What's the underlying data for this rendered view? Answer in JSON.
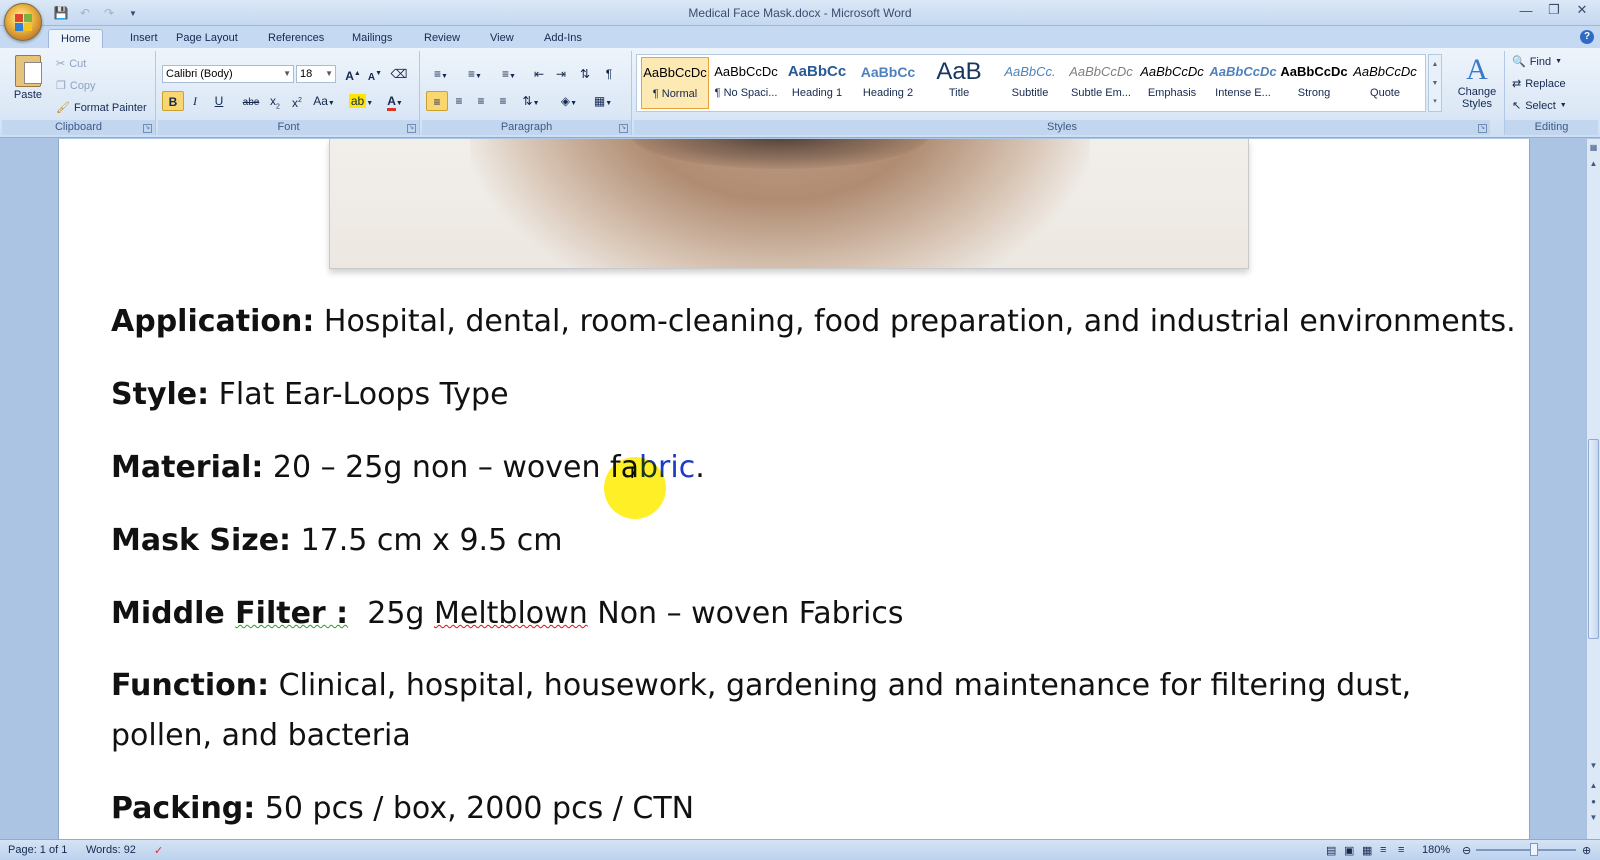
{
  "window": {
    "title": "Medical Face Mask.docx - Microsoft Word"
  },
  "tabs": [
    {
      "label": "Home"
    },
    {
      "label": "Insert"
    },
    {
      "label": "Page Layout"
    },
    {
      "label": "References"
    },
    {
      "label": "Mailings"
    },
    {
      "label": "Review"
    },
    {
      "label": "View"
    },
    {
      "label": "Add-Ins"
    }
  ],
  "clipboard": {
    "paste": "Paste",
    "cut": "Cut",
    "copy": "Copy",
    "format_painter": "Format Painter",
    "label": "Clipboard"
  },
  "font": {
    "name": "Calibri (Body)",
    "size": "18",
    "label": "Font"
  },
  "paragraph": {
    "label": "Paragraph"
  },
  "styles": {
    "label": "Styles",
    "items": [
      {
        "sample": "AaBbCcDc",
        "name": "¶ Normal"
      },
      {
        "sample": "AaBbCcDc",
        "name": "¶ No Spaci..."
      },
      {
        "sample": "AaBbCc",
        "name": "Heading 1"
      },
      {
        "sample": "AaBbCc",
        "name": "Heading 2"
      },
      {
        "sample": "AaB",
        "name": "Title"
      },
      {
        "sample": "AaBbCc.",
        "name": "Subtitle"
      },
      {
        "sample": "AaBbCcDc",
        "name": "Subtle Em..."
      },
      {
        "sample": "AaBbCcDc",
        "name": "Emphasis"
      },
      {
        "sample": "AaBbCcDc",
        "name": "Intense E..."
      },
      {
        "sample": "AaBbCcDc",
        "name": "Strong"
      },
      {
        "sample": "AaBbCcDc",
        "name": "Quote"
      }
    ],
    "change_styles": "Change Styles"
  },
  "editing": {
    "label": "Editing",
    "find": "Find",
    "replace": "Replace",
    "select": "Select"
  },
  "document": {
    "application_label": "Application:",
    "application_text": " Hospital, dental, room-cleaning, food preparation, and industrial environments.",
    "style_label": "Style:",
    "style_text": " Flat Ear-Loops Type",
    "material_label": "Material:",
    "material_text_a": " 20 – 25g non – woven fa",
    "material_text_sel": "bric",
    "material_text_b": ".",
    "mask_size_label": "Mask Size:",
    "mask_size_text": " 17.5 cm x 9.5 cm",
    "middle_filter_label_a": "Middle ",
    "middle_filter_label_b": "Filter :",
    "middle_filter_text_a": "  25g ",
    "middle_filter_text_b": "Meltblown",
    "middle_filter_text_c": " Non – woven Fabrics",
    "function_label": "Function:",
    "function_text": " Clinical, hospital, housework, gardening and maintenance for filtering dust, pollen, and bacteria",
    "packing_label": "Packing:",
    "packing_text": " 50 pcs / box, 2000 pcs / CTN"
  },
  "status": {
    "page": "Page: 1 of 1",
    "words": "Words: 92",
    "zoom": "180%"
  }
}
